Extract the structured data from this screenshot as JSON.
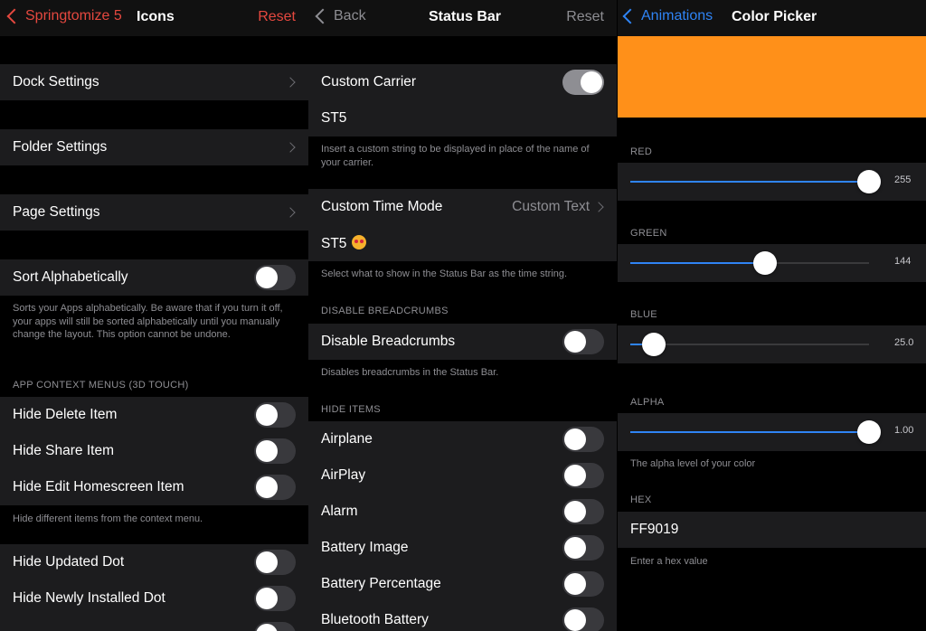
{
  "colors": {
    "accent_red": "#e5483f",
    "accent_blue": "#2f84f5",
    "picked": "#FF9019"
  },
  "panel1": {
    "nav": {
      "back": "Springtomize 5",
      "title": "Icons",
      "right": "Reset"
    },
    "rows": {
      "dock": "Dock Settings",
      "folder": "Folder Settings",
      "page": "Page Settings",
      "sort": "Sort Alphabetically"
    },
    "sort_footer": "Sorts your Apps alphabetically. Be aware that if you turn it off, your apps will still be sorted alphabetically until you manually change the layout. This option cannot be undone.",
    "context_header": "APP CONTEXT MENUS (3D TOUCH)",
    "context_items": [
      "Hide Delete Item",
      "Hide Share Item",
      "Hide Edit Homescreen Item"
    ],
    "context_footer": "Hide different items from the context menu.",
    "dot_items": [
      "Hide Updated Dot",
      "Hide Newly Installed Dot"
    ]
  },
  "panel2": {
    "nav": {
      "back": "Back",
      "title": "Status Bar",
      "right": "Reset"
    },
    "carrier": {
      "label": "Custom Carrier",
      "value": "ST5",
      "footer": "Insert a custom string to be displayed in place of the name of your carrier."
    },
    "time": {
      "label": "Custom Time Mode",
      "value": "Custom Text",
      "text": "ST5",
      "footer": "Select what to show in the Status Bar as the time string."
    },
    "breadcrumbs": {
      "header": "DISABLE BREADCRUMBS",
      "label": "Disable Breadcrumbs",
      "footer": "Disables breadcrumbs in the Status Bar."
    },
    "hide_header": "HIDE ITEMS",
    "hide_items": [
      "Airplane",
      "AirPlay",
      "Alarm",
      "Battery Image",
      "Battery Percentage",
      "Bluetooth Battery"
    ]
  },
  "panel3": {
    "nav": {
      "back": "Animations",
      "title": "Color Picker"
    },
    "red": {
      "label": "RED",
      "value": "255",
      "fraction": 1.0
    },
    "green": {
      "label": "GREEN",
      "value": "144",
      "fraction": 0.565
    },
    "blue": {
      "label": "BLUE",
      "value": "25.0",
      "fraction": 0.098
    },
    "alpha": {
      "label": "ALPHA",
      "value": "1.00",
      "fraction": 1.0,
      "footer": "The alpha level of your color"
    },
    "hex": {
      "label": "HEX",
      "value": "FF9019",
      "footer": "Enter a hex value"
    }
  }
}
